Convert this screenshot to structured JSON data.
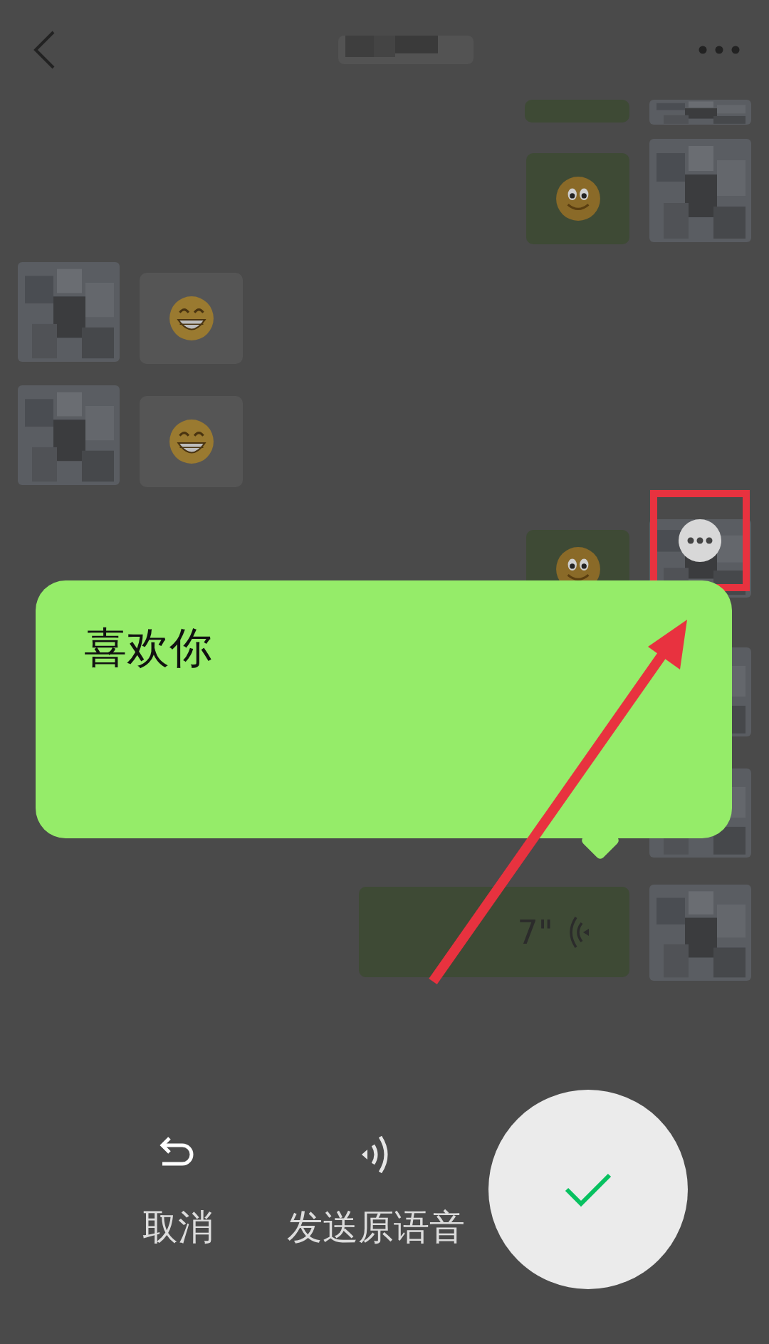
{
  "messages": [
    {
      "outgoing": true,
      "kind": "partial"
    },
    {
      "outgoing": true,
      "kind": "smile"
    },
    {
      "outgoing": false,
      "kind": "grin"
    },
    {
      "outgoing": false,
      "kind": "grin"
    },
    {
      "outgoing": true,
      "kind": "smile",
      "highlighted": true
    },
    {
      "outgoing": true,
      "kind": "none"
    },
    {
      "outgoing": true,
      "kind": "none"
    },
    {
      "outgoing": true,
      "kind": "voice",
      "duration": "7\""
    }
  ],
  "transcription": {
    "text": "喜欢你"
  },
  "actions": [
    {
      "kind": "cancel",
      "label": "取消"
    },
    {
      "kind": "send-voice",
      "label": "发送原语音"
    }
  ],
  "confirm": {
    "kind": "check"
  }
}
